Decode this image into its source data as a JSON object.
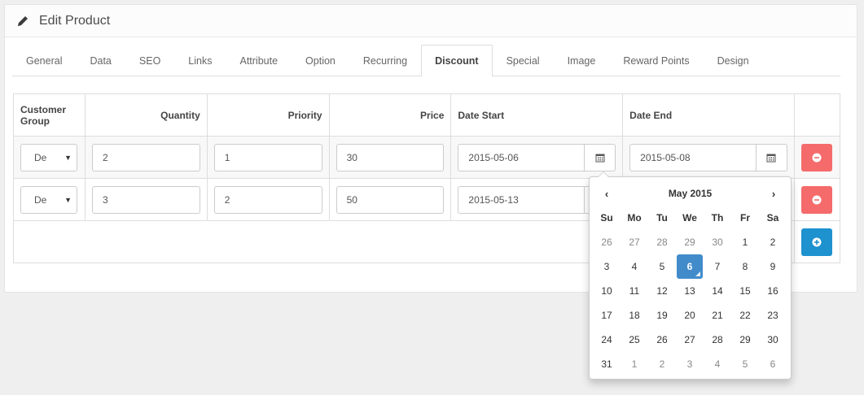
{
  "header": {
    "title": "Edit Product"
  },
  "tabs": [
    {
      "label": "General"
    },
    {
      "label": "Data"
    },
    {
      "label": "SEO"
    },
    {
      "label": "Links"
    },
    {
      "label": "Attribute"
    },
    {
      "label": "Option"
    },
    {
      "label": "Recurring"
    },
    {
      "label": "Discount"
    },
    {
      "label": "Special"
    },
    {
      "label": "Image"
    },
    {
      "label": "Reward Points"
    },
    {
      "label": "Design"
    }
  ],
  "active_tab": "Discount",
  "table": {
    "headers": {
      "customer_group": "Customer Group",
      "quantity": "Quantity",
      "priority": "Priority",
      "price": "Price",
      "date_start": "Date Start",
      "date_end": "Date End"
    },
    "rows": [
      {
        "customer_group": "De",
        "quantity": "2",
        "priority": "1",
        "price": "30",
        "date_start": "2015-05-06",
        "date_end": "2015-05-08"
      },
      {
        "customer_group": "De",
        "quantity": "3",
        "priority": "2",
        "price": "50",
        "date_start": "2015-05-13",
        "date_end": ""
      }
    ]
  },
  "datepicker": {
    "prev": "‹",
    "next": "›",
    "month_label": "May 2015",
    "dow": [
      "Su",
      "Mo",
      "Tu",
      "We",
      "Th",
      "Fr",
      "Sa"
    ],
    "days": [
      {
        "d": "26",
        "muted": true
      },
      {
        "d": "27",
        "muted": true
      },
      {
        "d": "28",
        "muted": true
      },
      {
        "d": "29",
        "muted": true
      },
      {
        "d": "30",
        "muted": true
      },
      {
        "d": "1"
      },
      {
        "d": "2"
      },
      {
        "d": "3"
      },
      {
        "d": "4"
      },
      {
        "d": "5"
      },
      {
        "d": "6",
        "active": true
      },
      {
        "d": "7"
      },
      {
        "d": "8"
      },
      {
        "d": "9"
      },
      {
        "d": "10"
      },
      {
        "d": "11"
      },
      {
        "d": "12"
      },
      {
        "d": "13"
      },
      {
        "d": "14"
      },
      {
        "d": "15"
      },
      {
        "d": "16"
      },
      {
        "d": "17"
      },
      {
        "d": "18"
      },
      {
        "d": "19"
      },
      {
        "d": "20"
      },
      {
        "d": "21"
      },
      {
        "d": "22"
      },
      {
        "d": "23"
      },
      {
        "d": "24"
      },
      {
        "d": "25"
      },
      {
        "d": "26"
      },
      {
        "d": "27"
      },
      {
        "d": "28"
      },
      {
        "d": "29"
      },
      {
        "d": "30"
      },
      {
        "d": "31"
      },
      {
        "d": "1",
        "muted": true
      },
      {
        "d": "2",
        "muted": true
      },
      {
        "d": "3",
        "muted": true
      },
      {
        "d": "4",
        "muted": true
      },
      {
        "d": "5",
        "muted": true
      },
      {
        "d": "6",
        "muted": true
      }
    ]
  },
  "colors": {
    "remove_button": "#f56b6b",
    "add_button": "#1e91cf",
    "active_day": "#428bca"
  },
  "icons": {
    "header": "pencil-icon",
    "date_button": "calendar-icon",
    "remove": "minus-circle-icon",
    "add": "plus-circle-icon"
  }
}
